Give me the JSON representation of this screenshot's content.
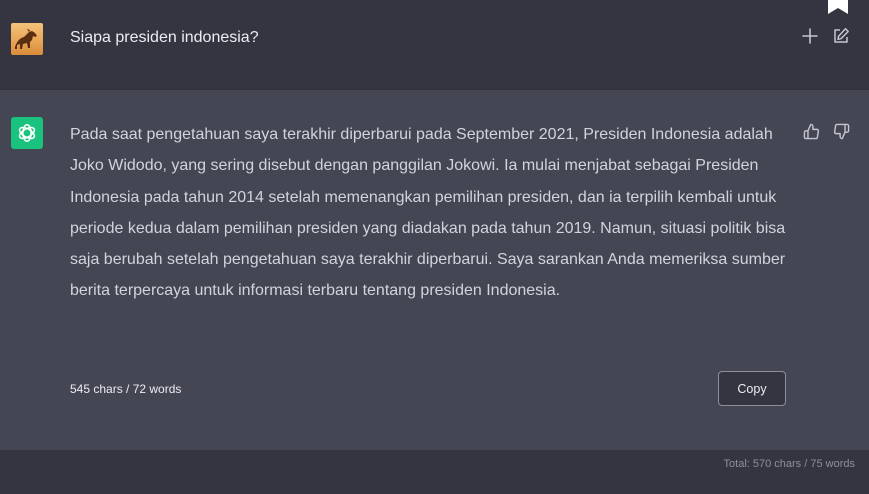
{
  "prompt": {
    "text": "Siapa presiden indonesia?",
    "new_chat_icon": "plus-icon",
    "edit_icon": "edit-icon",
    "bookmark_icon": "bookmark-icon"
  },
  "response": {
    "text": "Pada saat pengetahuan saya terakhir diperbarui pada September 2021, Presiden Indonesia adalah Joko Widodo, yang sering disebut dengan panggilan Jokowi. Ia mulai menjabat sebagai Presiden Indonesia pada tahun 2014 setelah memenangkan pemilihan presiden, dan ia terpilih kembali untuk periode kedua dalam pemilihan presiden yang diadakan pada tahun 2019. Namun, situasi politik bisa saja berubah setelah pengetahuan saya terakhir diperbarui. Saya sarankan Anda memeriksa sumber berita terpercaya untuk informasi terbaru tentang presiden Indonesia.",
    "stats": "545 chars / 72 words",
    "copy_label": "Copy",
    "thumbs_up_icon": "thumbs-up-icon",
    "thumbs_down_icon": "thumbs-down-icon"
  },
  "footer": {
    "total": "Total: 570 chars / 75 words"
  },
  "colors": {
    "accent": "#19c37d",
    "page_bg": "#343541",
    "response_bg": "#444654"
  }
}
